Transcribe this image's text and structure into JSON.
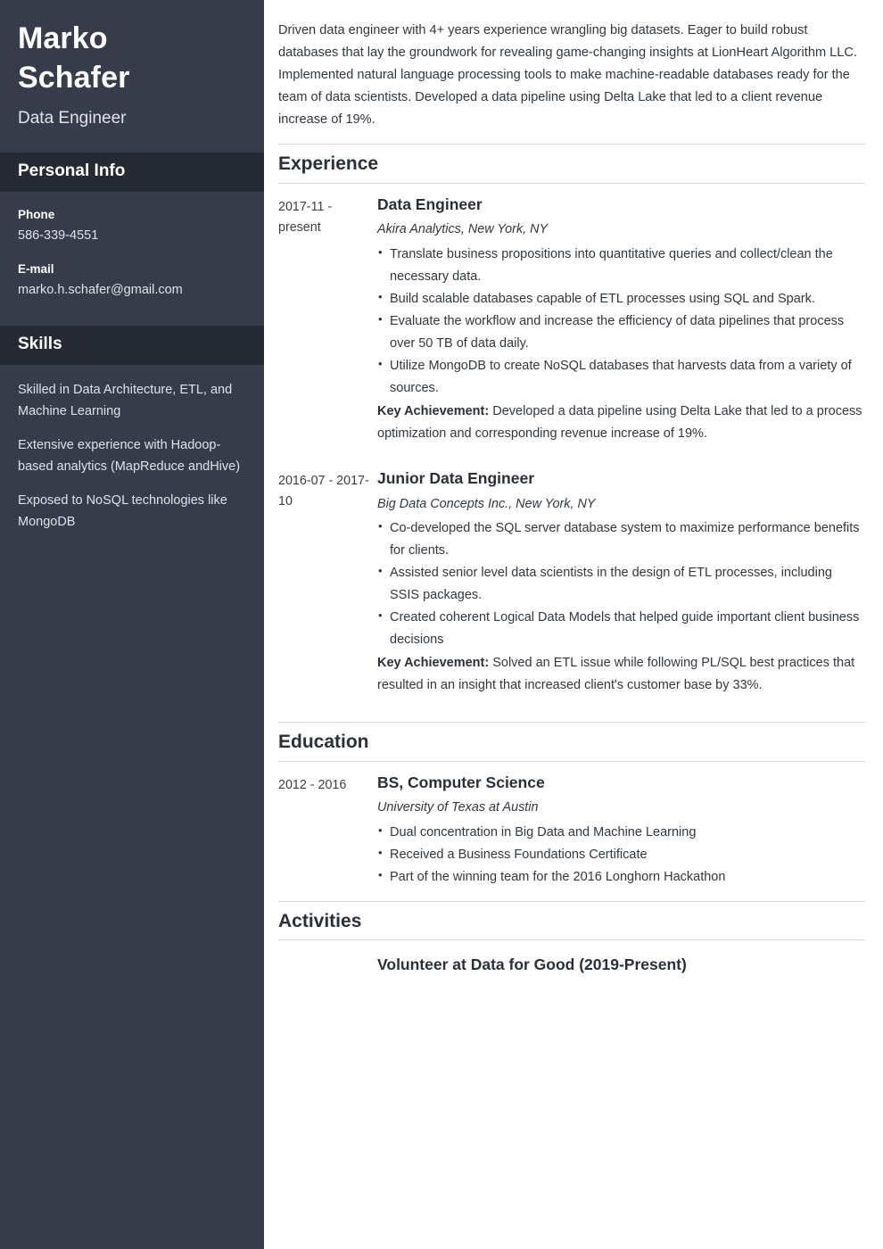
{
  "sidebar": {
    "name": "Marko Schafer",
    "job_title": "Data Engineer",
    "personal_info": {
      "heading": "Personal Info",
      "items": [
        {
          "label": "Phone",
          "value": "586-339-4551"
        },
        {
          "label": "E-mail",
          "value": "marko.h.schafer@gmail.com"
        }
      ]
    },
    "skills": {
      "heading": "Skills",
      "items": [
        "Skilled in Data Architecture, ETL, and Machine Learning",
        "Extensive experience with Hadoop-based analytics (MapReduce andHive)",
        "Exposed to NoSQL technologies like MongoDB"
      ]
    }
  },
  "main": {
    "summary": "Driven data engineer with 4+ years experience wrangling big datasets. Eager to build robust databases that lay the groundwork for revealing game-changing insights at LionHeart Algorithm LLC. Implemented natural language processing tools to make machine-readable databases ready for the team of data scientists. Developed a data pipeline using Delta Lake that led to a client revenue increase of 19%.",
    "sections": {
      "experience": {
        "heading": "Experience",
        "entries": [
          {
            "date": "2017-11 - present",
            "role": "Data Engineer",
            "org": "Akira Analytics, New York, NY",
            "bullets": [
              "Translate business propositions into quantitative queries and collect/clean the necessary data.",
              "Build scalable databases capable of ETL processes using SQL and Spark.",
              "Evaluate the workflow and increase the efficiency of data pipelines that process over 50 TB of data daily.",
              "Utilize MongoDB to create NoSQL databases that harvests data from a variety of sources."
            ],
            "achievement_label": "Key Achievement:",
            "achievement_text": " Developed a data pipeline using Delta Lake that led to a process optimization and corresponding revenue increase of 19%."
          },
          {
            "date": "2016-07 - 2017-10",
            "role": "Junior Data Engineer",
            "org": "Big Data Concepts Inc., New York, NY",
            "bullets": [
              "Co-developed the SQL server database system to maximize performance benefits for clients.",
              "Assisted senior level data scientists in the design of ETL processes, including SSIS packages.",
              "Created coherent Logical Data Models that helped guide important client business decisions"
            ],
            "achievement_label": "Key Achievement:",
            "achievement_text": " Solved an ETL issue while following PL/SQL best practices that resulted in an insight that increased client's customer base by 33%."
          }
        ]
      },
      "education": {
        "heading": "Education",
        "entries": [
          {
            "date": "2012 - 2016",
            "degree": "BS, Computer Science",
            "org": "University of Texas at Austin",
            "bullets": [
              "Dual concentration in Big Data and Machine Learning",
              "Received a Business Foundations Certificate",
              "Part of the winning team for the 2016 Longhorn Hackathon"
            ]
          }
        ]
      },
      "activities": {
        "heading": "Activities",
        "entries": [
          {
            "title": "Volunteer at Data for Good (2019-Present)"
          }
        ]
      }
    }
  },
  "colors": {
    "sidebar_bg": "#363c49",
    "sidebar_band_bg": "#252933",
    "text_dark": "#2b2f38",
    "rule": "#d7d9dd"
  }
}
